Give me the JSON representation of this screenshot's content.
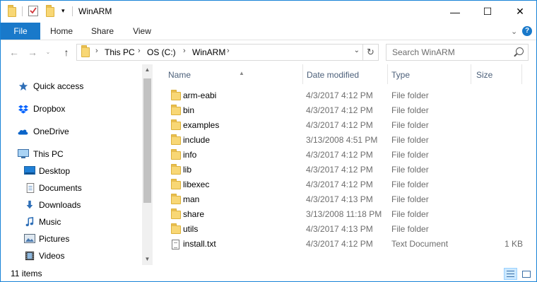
{
  "window": {
    "title": "WinARM",
    "controls": {
      "minimize": "—",
      "maximize": "☐",
      "close": "✕"
    }
  },
  "ribbon": {
    "tabs": [
      "File",
      "Home",
      "Share",
      "View"
    ],
    "collapse_glyph": "⌄",
    "help_glyph": "?"
  },
  "address": {
    "breadcrumbs": [
      "This PC",
      "OS (C:)",
      "WinARM"
    ],
    "separator": "›"
  },
  "search": {
    "placeholder": "Search WinARM"
  },
  "navigation": {
    "items": [
      {
        "label": "Quick access",
        "icon": "star-icon"
      },
      {
        "label": "Dropbox",
        "icon": "dropbox-icon"
      },
      {
        "label": "OneDrive",
        "icon": "cloud-icon"
      },
      {
        "label": "This PC",
        "icon": "computer-icon"
      },
      {
        "label": "Desktop",
        "icon": "desktop-icon"
      },
      {
        "label": "Documents",
        "icon": "documents-icon"
      },
      {
        "label": "Downloads",
        "icon": "download-arrow-icon"
      },
      {
        "label": "Music",
        "icon": "music-note-icon"
      },
      {
        "label": "Pictures",
        "icon": "pictures-icon"
      },
      {
        "label": "Videos",
        "icon": "film-icon"
      }
    ]
  },
  "columns": {
    "name": "Name",
    "date": "Date modified",
    "type": "Type",
    "size": "Size"
  },
  "files": [
    {
      "name": "arm-eabi",
      "date": "4/3/2017 4:12 PM",
      "type": "File folder",
      "size": "",
      "kind": "folder"
    },
    {
      "name": "bin",
      "date": "4/3/2017 4:12 PM",
      "type": "File folder",
      "size": "",
      "kind": "folder"
    },
    {
      "name": "examples",
      "date": "4/3/2017 4:12 PM",
      "type": "File folder",
      "size": "",
      "kind": "folder"
    },
    {
      "name": "include",
      "date": "3/13/2008 4:51 PM",
      "type": "File folder",
      "size": "",
      "kind": "folder"
    },
    {
      "name": "info",
      "date": "4/3/2017 4:12 PM",
      "type": "File folder",
      "size": "",
      "kind": "folder"
    },
    {
      "name": "lib",
      "date": "4/3/2017 4:12 PM",
      "type": "File folder",
      "size": "",
      "kind": "folder"
    },
    {
      "name": "libexec",
      "date": "4/3/2017 4:12 PM",
      "type": "File folder",
      "size": "",
      "kind": "folder"
    },
    {
      "name": "man",
      "date": "4/3/2017 4:13 PM",
      "type": "File folder",
      "size": "",
      "kind": "folder"
    },
    {
      "name": "share",
      "date": "3/13/2008 11:18 PM",
      "type": "File folder",
      "size": "",
      "kind": "folder"
    },
    {
      "name": "utils",
      "date": "4/3/2017 4:13 PM",
      "type": "File folder",
      "size": "",
      "kind": "folder"
    },
    {
      "name": "install.txt",
      "date": "4/3/2017 4:12 PM",
      "type": "Text Document",
      "size": "1 KB",
      "kind": "text-file"
    }
  ],
  "status": {
    "item_count": "11 items"
  },
  "colors": {
    "accent": "#1979ca",
    "folder": "#f8d775",
    "header_text": "#4c607a",
    "secondary_text": "#6d6d6d"
  }
}
